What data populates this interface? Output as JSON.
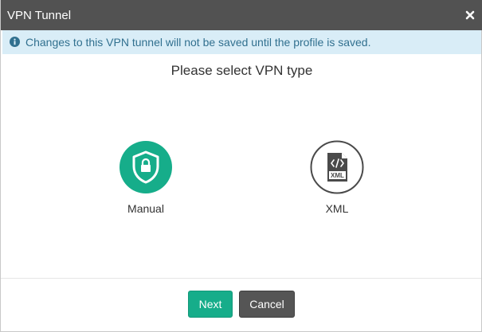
{
  "dialog": {
    "title": "VPN Tunnel",
    "close_icon": "close-icon"
  },
  "info": {
    "icon": "info-circle-icon",
    "message": "Changes to this VPN tunnel will not be saved until the profile is saved."
  },
  "main": {
    "heading": "Please select VPN type",
    "options": [
      {
        "label": "Manual",
        "icon": "shield-lock-icon",
        "selected": true
      },
      {
        "label": "XML",
        "icon": "xml-file-icon",
        "selected": false
      }
    ]
  },
  "footer": {
    "next_label": "Next",
    "cancel_label": "Cancel"
  },
  "colors": {
    "titlebar": "#525252",
    "info_bg": "#d9edf7",
    "info_text": "#31708f",
    "accent": "#16ad8a",
    "cancel": "#555555"
  }
}
